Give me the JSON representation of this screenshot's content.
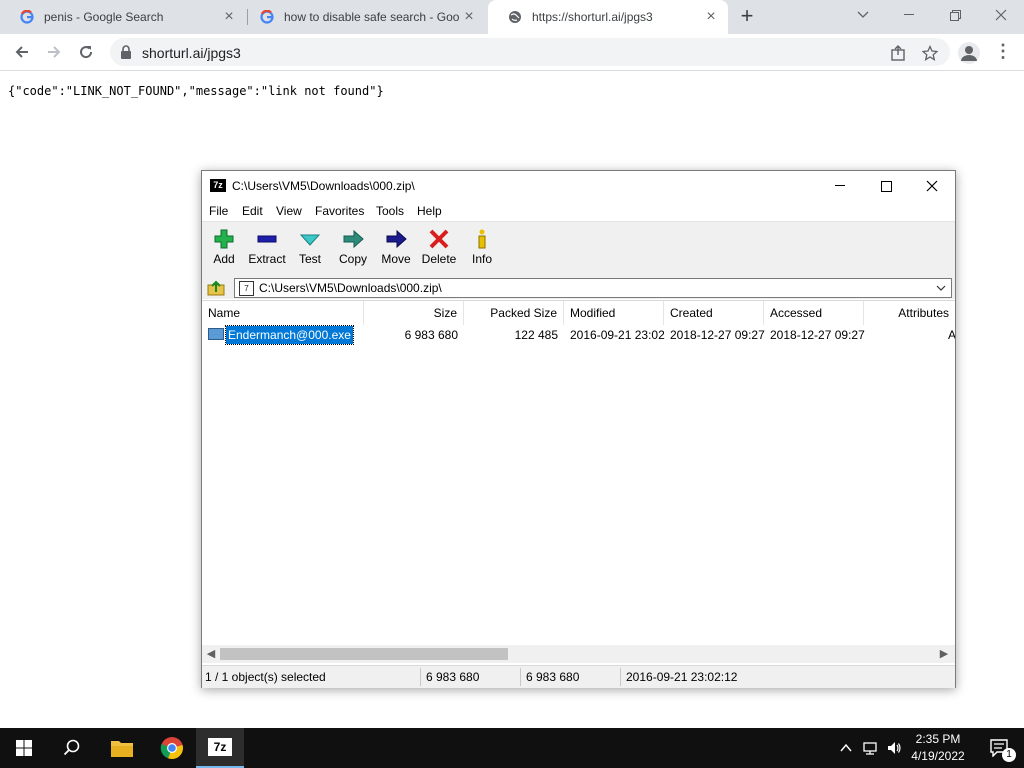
{
  "browser": {
    "tabs": [
      {
        "title": "penis - Google Search",
        "favicon": "google-icon"
      },
      {
        "title": "how to disable safe search - Goo",
        "favicon": "google-icon"
      },
      {
        "title": "https://shorturl.ai/jpgs3",
        "favicon": "globe-icon"
      }
    ],
    "url": "shorturl.ai/jpgs3",
    "page_text": "{\"code\":\"LINK_NOT_FOUND\",\"message\":\"link not found\"}"
  },
  "sevenzip": {
    "title": "C:\\Users\\VM5\\Downloads\\000.zip\\",
    "menu": [
      "File",
      "Edit",
      "View",
      "Favorites",
      "Tools",
      "Help"
    ],
    "tools": [
      {
        "label": "Add",
        "icon": "add-icon"
      },
      {
        "label": "Extract",
        "icon": "extract-icon"
      },
      {
        "label": "Test",
        "icon": "test-icon"
      },
      {
        "label": "Copy",
        "icon": "copy-icon"
      },
      {
        "label": "Move",
        "icon": "move-icon"
      },
      {
        "label": "Delete",
        "icon": "delete-icon"
      },
      {
        "label": "Info",
        "icon": "info-icon"
      }
    ],
    "address": "C:\\Users\\VM5\\Downloads\\000.zip\\",
    "columns": [
      "Name",
      "Size",
      "Packed Size",
      "Modified",
      "Created",
      "Accessed",
      "Attributes"
    ],
    "rows": [
      {
        "name": "Endermanch@000.exe",
        "size": "6 983 680",
        "packed": "122 485",
        "modified": "2016-09-21 23:02",
        "created": "2018-12-27 09:27",
        "accessed": "2018-12-27 09:27",
        "attributes": "A",
        "selected": true
      }
    ],
    "status": {
      "selection": "1 / 1 object(s) selected",
      "size": "6 983 680",
      "packed": "6 983 680",
      "modified": "2016-09-21 23:02:12"
    }
  },
  "taskbar": {
    "apps": [
      "start-icon",
      "search-icon",
      "file-explorer-icon",
      "chrome-icon",
      "7zip-icon"
    ],
    "time": "2:35 PM",
    "date": "4/19/2022",
    "notification_count": "1",
    "sevenzip_badge": "7z"
  },
  "colors": {
    "chrome_tabstrip": "#dee1e6",
    "selection_blue": "#0078d7",
    "taskbar": "#101010"
  }
}
